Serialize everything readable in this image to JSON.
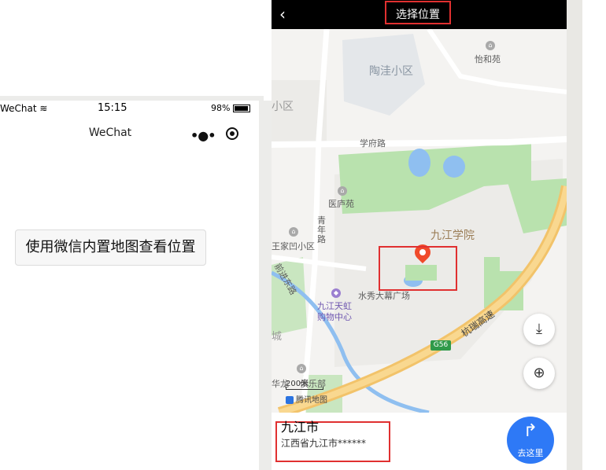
{
  "left_phone": {
    "status": {
      "carrier": "WeChat",
      "time": "15:15",
      "battery": "98%"
    },
    "nav": {
      "title": "WeChat"
    },
    "button_label": "使用微信内置地图查看位置"
  },
  "map_page": {
    "header_title": "选择位置",
    "labels": {
      "taowa": "陶洼小区",
      "yihe": "怡和苑",
      "xiaoqu": "小区",
      "xuefu_road": "学府路",
      "yilu": "医庐苑",
      "qingnian_road": "青年路",
      "jiujiang_college": "九江学院",
      "wangjiaao": "王家凹小区",
      "tianhong": "九江天虹购物中心",
      "shuixiu": "水秀大幕广场",
      "qianjin_road": "前进东路",
      "hangrui": "杭瑞高速",
      "cheng": "城",
      "hualong": "华龙",
      "club": "俱乐部"
    },
    "road_badge": "G56",
    "scale": "200米",
    "logo": "腾讯地图",
    "info": {
      "name": "九江市",
      "address": "江西省九江市******"
    },
    "go_label": "去这里"
  },
  "colors": {
    "accent": "#2e79f6",
    "pin": "#f04a2a",
    "highlight_box": "#e03030"
  }
}
